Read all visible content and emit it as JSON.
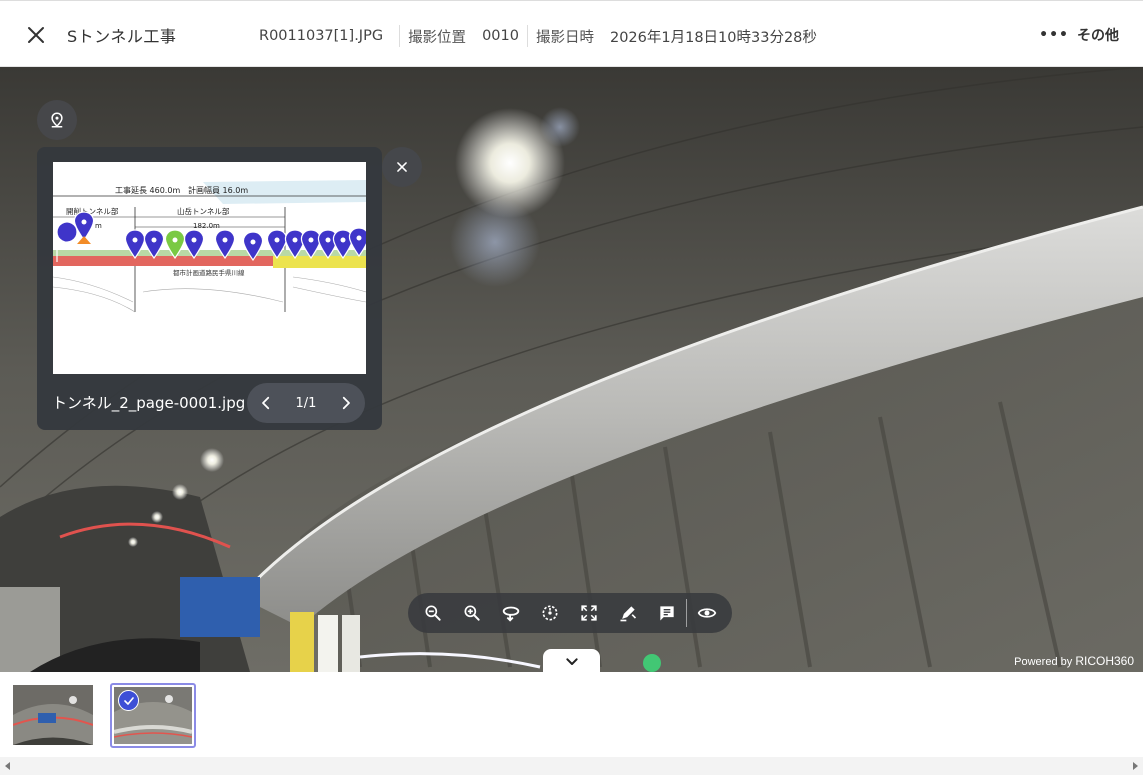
{
  "header": {
    "title": "Sトンネル工事",
    "filename": "R0011037[1].JPG",
    "position_label": "撮影位置",
    "position_value": "0010",
    "datetime_label": "撮影日時",
    "datetime_value": "2026年1月18日10時33分28秒",
    "more_label": "その他"
  },
  "map_panel": {
    "file_name": "トンネル_2_page-0001.jpg",
    "page_indicator": "1/1",
    "drawing": {
      "length_text": "工事延長 460.0m",
      "width_text": "計画幅員 16.0m",
      "left_section": "開削トンネル部",
      "right_section": "山岳トンネル部",
      "right_section_length": "182.0m",
      "left_section_length": "m",
      "road_label": "都市計画道路民手県川線"
    }
  },
  "toolbar": {
    "tools": [
      {
        "icon": "zoom-out-icon"
      },
      {
        "icon": "zoom-in-icon"
      },
      {
        "icon": "rotate-view-icon"
      },
      {
        "icon": "compass-icon"
      },
      {
        "icon": "fullscreen-icon"
      },
      {
        "icon": "markup-pen-icon"
      },
      {
        "icon": "comment-icon"
      },
      {
        "icon": "eye-icon"
      }
    ]
  },
  "viewer": {
    "powered_prefix": "Powered by",
    "powered_brand": "RICOH360"
  },
  "filmstrip": {
    "selected_index": 1
  },
  "colors": {
    "pin_blue": "#3f35c9",
    "pin_green": "#7ac943",
    "check_blue": "#3d4fd6",
    "panel_bg": "#34383e"
  }
}
